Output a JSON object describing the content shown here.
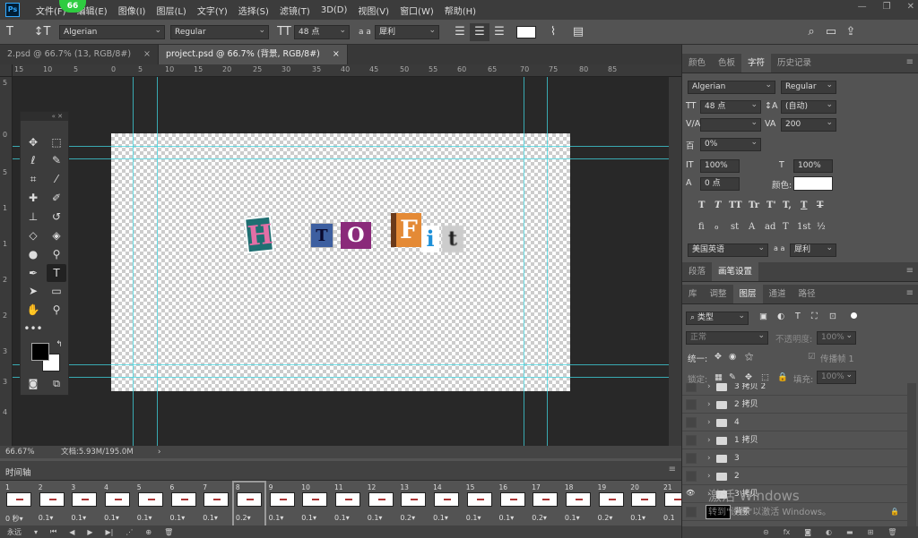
{
  "menubar": {
    "badge": "66",
    "items": [
      "文件(F)",
      "编辑(E)",
      "图像(I)",
      "图层(L)",
      "文字(Y)",
      "选择(S)",
      "滤镜(T)",
      "3D(D)",
      "视图(V)",
      "窗口(W)",
      "帮助(H)"
    ],
    "logo": "Ps"
  },
  "window_controls": {
    "minimize": "—",
    "restore": "❐",
    "close": "✕"
  },
  "options": {
    "font_family": "Algerian",
    "font_style": "Regular",
    "font_size": "48 点",
    "aa_icon": "a a",
    "antialias": "犀利"
  },
  "tabs": [
    {
      "label": "2.psd @ 66.7% (13, RGB/8#)"
    },
    {
      "label": "project.psd @ 66.7% (背景, RGB/8#)"
    }
  ],
  "ruler": {
    "h_ticks": [
      "15",
      "10",
      "5",
      "0",
      "5",
      "10",
      "15",
      "20",
      "25",
      "30",
      "35",
      "40",
      "45",
      "50",
      "55",
      "60",
      "65",
      "70",
      "75",
      "80",
      "85"
    ],
    "v_ticks": [
      "5",
      "0",
      "5",
      "1",
      "1",
      "2",
      "2",
      "3",
      "3",
      "4"
    ]
  },
  "canvas": {
    "letters": [
      "H",
      "T",
      "O",
      "F",
      "i",
      "t"
    ]
  },
  "status": {
    "zoom": "66.67%",
    "doc": "文档:5.93M/195.0M",
    "arrow": "›"
  },
  "timeline": {
    "title": "时间轴",
    "frames": [
      {
        "n": "1",
        "t": "0 秒▾"
      },
      {
        "n": "2",
        "t": "0.1▾"
      },
      {
        "n": "3",
        "t": "0.1▾"
      },
      {
        "n": "4",
        "t": "0.1▾"
      },
      {
        "n": "5",
        "t": "0.1▾"
      },
      {
        "n": "6",
        "t": "0.1▾"
      },
      {
        "n": "7",
        "t": "0.1▾"
      },
      {
        "n": "8",
        "t": "0.2▾"
      },
      {
        "n": "9",
        "t": "0.1▾"
      },
      {
        "n": "10",
        "t": "0.1▾"
      },
      {
        "n": "11",
        "t": "0.1▾"
      },
      {
        "n": "12",
        "t": "0.1▾"
      },
      {
        "n": "13",
        "t": "0.2▾"
      },
      {
        "n": "14",
        "t": "0.1▾"
      },
      {
        "n": "15",
        "t": "0.1▾"
      },
      {
        "n": "16",
        "t": "0.1▾"
      },
      {
        "n": "17",
        "t": "0.2▾"
      },
      {
        "n": "18",
        "t": "0.1▾"
      },
      {
        "n": "19",
        "t": "0.2▾"
      },
      {
        "n": "20",
        "t": "0.1▾"
      },
      {
        "n": "21",
        "t": "0.1"
      }
    ],
    "loop": "永远",
    "menu": "≡"
  },
  "panel_char": {
    "tabs": [
      "颜色",
      "色板",
      "字符",
      "历史记录"
    ],
    "font": "Algerian",
    "style": "Regular",
    "size": "48 点",
    "leading": "(自动)",
    "tracking": "200",
    "scale_pct": "0%",
    "vscale": "100%",
    "hscale": "100%",
    "baseline": "0 点",
    "color_label": "颜色:",
    "language": "美国英语",
    "aa": "犀利",
    "glyphs": [
      "T",
      "T",
      "TT",
      "Tr",
      "T'",
      "T,",
      "T",
      "T"
    ],
    "ot_glyphs": [
      "fi",
      "ℴ",
      "st",
      "A",
      "ad",
      "T",
      "1st",
      "½"
    ],
    "icons": {
      "size": "TT",
      "leading": "↕A",
      "kerning": "V/A",
      "tracking": "VA",
      "scale": "百",
      "vscale": "IT",
      "hscale": "T",
      "baseline": "A"
    }
  },
  "panel_para": {
    "tabs": [
      "段落",
      "画笔设置"
    ]
  },
  "panel_layers": {
    "tabs": [
      "库",
      "调整",
      "图层",
      "通道",
      "路径"
    ],
    "filter": "类型",
    "blend": "正常",
    "opacity_label": "不透明度:",
    "opacity": "100%",
    "unify": "统一:",
    "propagate": "传播帧 1",
    "lock_label": "锁定:",
    "fill_label": "填充:",
    "fill": "100%",
    "layers": [
      "3 拷贝 2",
      "2 拷贝",
      "4",
      "1 拷贝",
      "3",
      "2",
      "3 拷贝",
      "背景"
    ],
    "filter_icons": [
      "▣",
      "◐",
      "T",
      "⛶",
      "⊡"
    ]
  },
  "watermark": {
    "line1": "激活 Windows",
    "line2": "转到\"设置\"以激活 Windows。"
  },
  "colors": {
    "accent": "#31a8ff",
    "guide": "#3fd6e0",
    "badge": "#2ecc40"
  }
}
